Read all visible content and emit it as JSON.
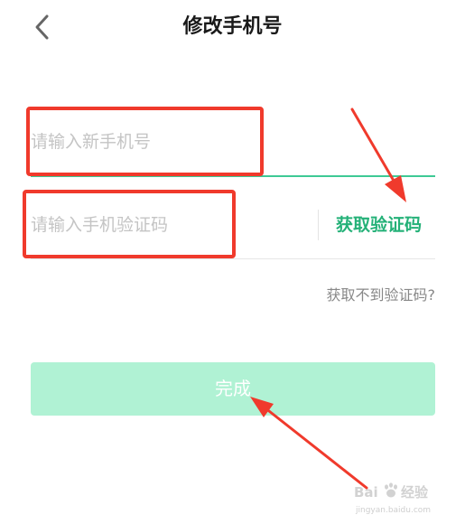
{
  "header": {
    "title": "修改手机号",
    "back_icon": "chevron-left-icon"
  },
  "form": {
    "phone_placeholder": "请输入新手机号",
    "phone_value": "",
    "code_placeholder": "请输入手机验证码",
    "code_value": "",
    "get_code_label": "获取验证码",
    "help_link_label": "获取不到验证码?",
    "submit_label": "完成"
  },
  "watermark": {
    "brand": "Baidu 经验",
    "url": "jingyan.baidu.com"
  },
  "colors": {
    "accent": "#24b178",
    "active_underline": "#3ec995",
    "button_bg": "#b0f2d4",
    "annotation_red": "#f03a2c"
  }
}
